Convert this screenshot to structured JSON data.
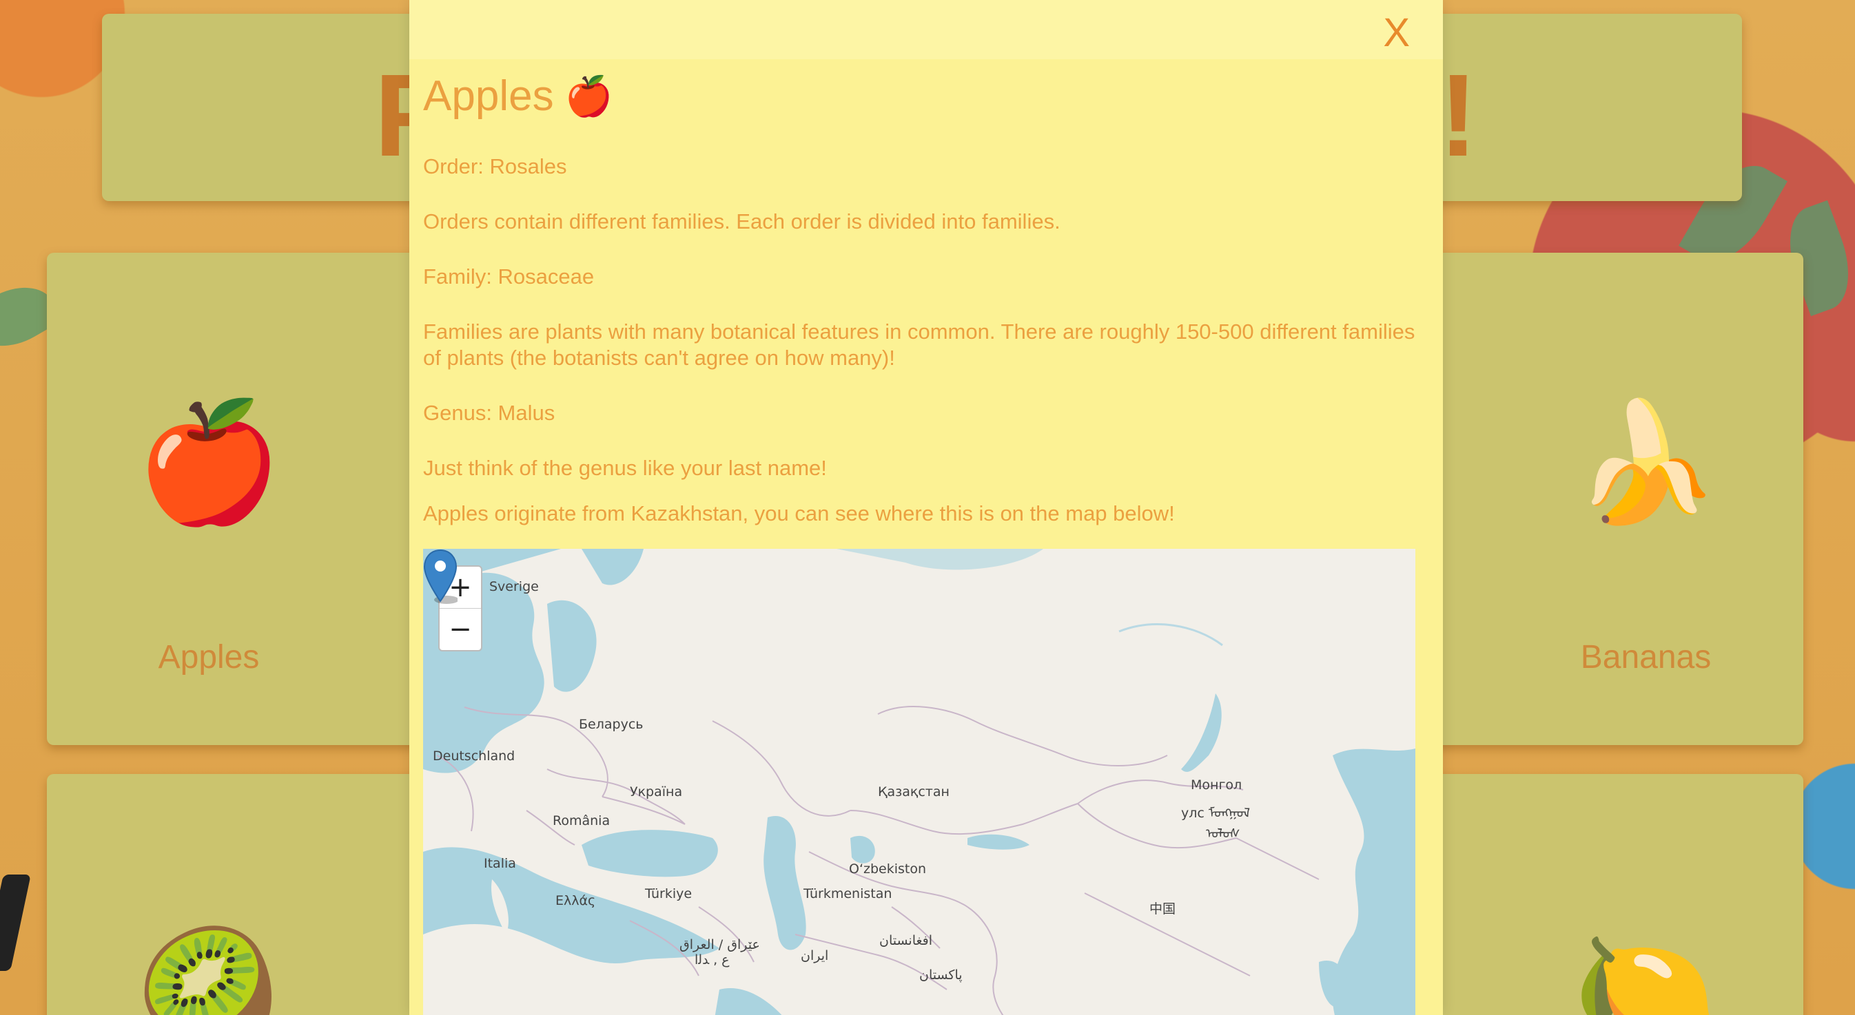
{
  "header": {
    "title_fragment_left": "F",
    "title_fragment_right": "!"
  },
  "cards": [
    {
      "name": "Apples",
      "emoji": "🍎"
    },
    {
      "name": "Bananas",
      "emoji": "🍌"
    },
    {
      "name": "",
      "emoji": "🥝"
    },
    {
      "name": "",
      "emoji": "🍋"
    }
  ],
  "modal": {
    "close_label": "X",
    "title": "Apples",
    "title_emoji": "🍎",
    "order": "Order: Rosales",
    "order_desc": "Orders contain different families. Each order is divided into families.",
    "family": "Family: Rosaceae",
    "family_desc": "Families are plants with many botanical features in common. There are roughly 150-500 different families of plants (the botanists can't agree on how many)!",
    "genus": "Genus: Malus",
    "genus_desc": "Just think of the genus like your last name!",
    "origin": "Apples originate from Kazakhstan, you can see where this is on the map below!"
  },
  "map": {
    "zoom_in": "+",
    "zoom_out": "−",
    "labels": {
      "sverige": "Sverige",
      "belarus": "Беларусь",
      "deutschland": "Deutschland",
      "ukraina": "Україна",
      "kazakhstan": "Қазақстан",
      "mongol": "Монгол",
      "mongol2": "улс ᠮᠤᠩᠭᠤᠯ",
      "mongol3": "ᠤᠯᠤᠰ",
      "romania": "România",
      "italia": "Italia",
      "uzbekiston": "O‘zbekiston",
      "turkiye": "Türkiye",
      "turkmenistan": "Türkmenistan",
      "ellas": "Ελλάς",
      "china": "中国",
      "iraq": "عێراق / العراق",
      "iran": "ایران",
      "afghanistan": "افغانستان",
      "pakistan": "پاکستان",
      "iraq2": "ﻉ , ﺪﻟﺍ"
    }
  }
}
